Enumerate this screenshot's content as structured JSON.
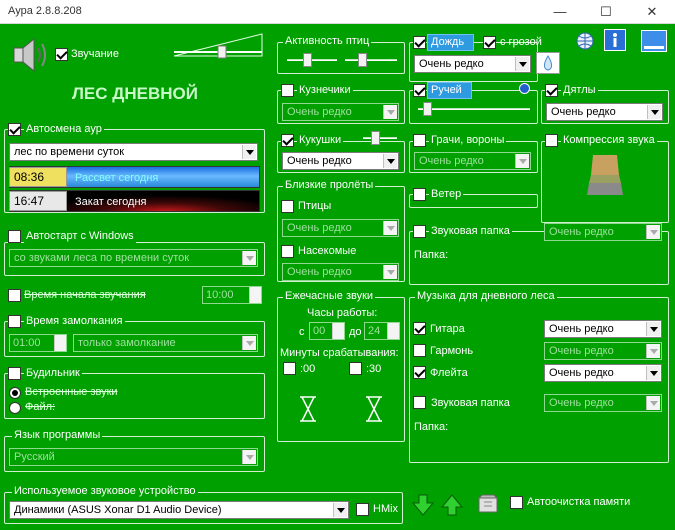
{
  "window": {
    "title": "Аура 2.8.8.208",
    "minimize": "—",
    "maximize": "☐",
    "close": "✕"
  },
  "header": {
    "sound_label": "Звучание",
    "sound_checked": true,
    "volume_level": 0.55,
    "scene_title": "ЛЕС ДНЕВНОЙ"
  },
  "auto_change": {
    "label": "Автосмена аур",
    "checked": true,
    "mode": "лес по времени суток",
    "sunrise_time": "08:36",
    "sunrise_text": "Рассвет сегодня",
    "sunset_time": "16:47",
    "sunset_text": "Закат сегодня"
  },
  "autostart": {
    "label": "Автостарт с Windows",
    "checked": false,
    "mode": "со звуками леса по времени суток"
  },
  "start_time": {
    "label": "Время начала звучания",
    "checked": false,
    "value": "10:00"
  },
  "lock_time": {
    "label": "Время замолкания",
    "checked": false,
    "value": "01:00",
    "mode": "только замолкание"
  },
  "alarm": {
    "label": "Будильник",
    "checked": false,
    "option_builtin": "Встроенные звуки",
    "option_file": "Файл:"
  },
  "language": {
    "label": "Язык программы",
    "value": "Русский"
  },
  "device": {
    "label": "Используемое звуковое устройство",
    "value": "Динамики (ASUS Xonar D1 Audio Device)",
    "hmix_label": "HMix",
    "hmix_checked": false
  },
  "memory": {
    "label": "Автоочистка памяти",
    "checked": false
  },
  "birds": {
    "label": "Активность птиц",
    "level_1": 0.4,
    "level_2": 0.3
  },
  "grasshoppers": {
    "label": "Кузнечики",
    "checked": false,
    "freq": "Очень редко"
  },
  "cuckoo": {
    "label": "Кукушки",
    "checked": true,
    "freq": "Очень редко",
    "level": 0.3
  },
  "flyby": {
    "label": "Близкие пролёты",
    "birds_label": "Птицы",
    "birds_checked": false,
    "birds_freq": "Очень редко",
    "insects_label": "Насекомые",
    "insects_checked": false,
    "insects_freq": "Очень редко"
  },
  "hourly": {
    "label": "Ежечасные звуки",
    "hours_label": "Часы работы:",
    "from_label": "с",
    "from_value": "00",
    "to_label": "до",
    "to_value": "24",
    "minutes_label": "Минуты срабатывания:",
    "m00_label": ":00",
    "m00_checked": false,
    "m30_label": ":30",
    "m30_checked": false
  },
  "rain": {
    "label": "Дождь",
    "checked": true,
    "thunder_label": "с грозой",
    "thunder_checked": true,
    "freq": "Очень редко"
  },
  "stream": {
    "label": "Ручей",
    "checked": true,
    "level": 0.05
  },
  "woodpecker": {
    "label": "Дятлы",
    "checked": true,
    "freq": "Очень редко"
  },
  "rooks": {
    "label": "Грачи, вороны",
    "checked": false,
    "freq": "Очень редко"
  },
  "compression": {
    "label": "Компрессия звука",
    "checked": false
  },
  "wind": {
    "label": "Ветер",
    "checked": false
  },
  "folder": {
    "label": "Звуковая папка",
    "checked": false,
    "freq": "Очень редко",
    "path_label": "Папка:"
  },
  "music": {
    "label": "Музыка для дневного леса",
    "items": [
      {
        "label": "Гитара",
        "checked": true,
        "freq": "Очень редко"
      },
      {
        "label": "Гармонь",
        "checked": false,
        "freq": "Очень редко"
      },
      {
        "label": "Флейта",
        "checked": true,
        "freq": "Очень редко"
      }
    ],
    "folder_label": "Звуковая папка",
    "folder_checked": false,
    "folder_freq": "Очень редко",
    "path_label": "Папка:"
  },
  "colors": {
    "background": "#00a000",
    "sunrise": "#2e9ae0",
    "sunset": "#c01818"
  }
}
